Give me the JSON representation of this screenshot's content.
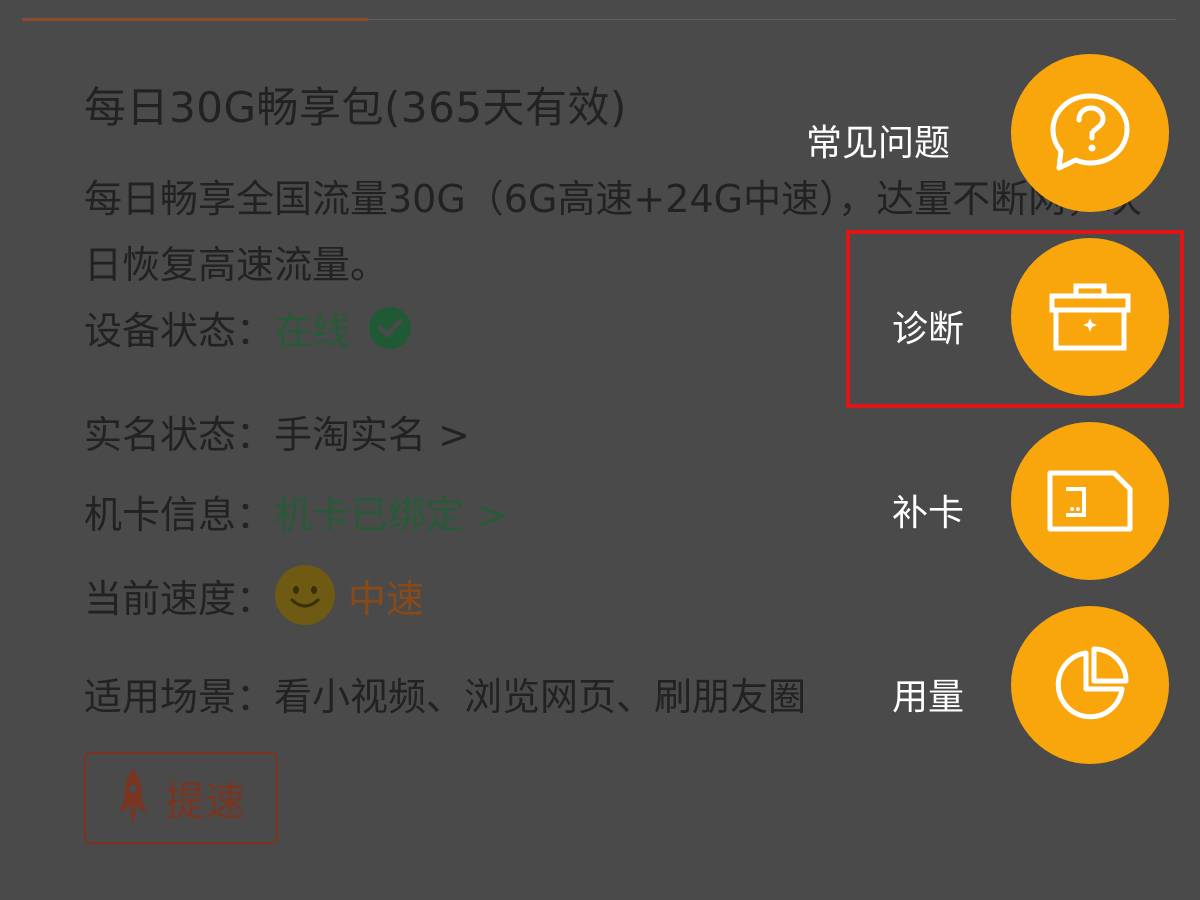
{
  "package": {
    "title": "每日30G畅享包(365天有效)",
    "description": "每日畅享全国流量30G（6G高速+24G中速），达量不断网，次日恢复高速流量。"
  },
  "info_rows": [
    {
      "label": "设备状态：",
      "value": "在线"
    },
    {
      "label": "实名状态：",
      "value": "手淘实名 >"
    },
    {
      "label": "机卡信息：",
      "value": "机卡已绑定 >"
    },
    {
      "label": "当前速度：",
      "value": "中速"
    },
    {
      "label": "适用场景：",
      "value": "看小视频、浏览网页、刷朋友圈"
    }
  ],
  "speedup_button": {
    "label": "提速"
  },
  "fab_menu": [
    {
      "label": "常见问题",
      "icon": "question-bubble-icon"
    },
    {
      "label": "诊断",
      "icon": "toolbox-icon"
    },
    {
      "label": "补卡",
      "icon": "sim-card-icon"
    },
    {
      "label": "用量",
      "icon": "pie-chart-icon"
    }
  ],
  "colors": {
    "overlay_background": "#4a4a4a",
    "fab_orange": "#f9a60c",
    "status_green": "#275a36",
    "speed_orange": "#8a4a18",
    "highlight_red": "#e01515"
  }
}
